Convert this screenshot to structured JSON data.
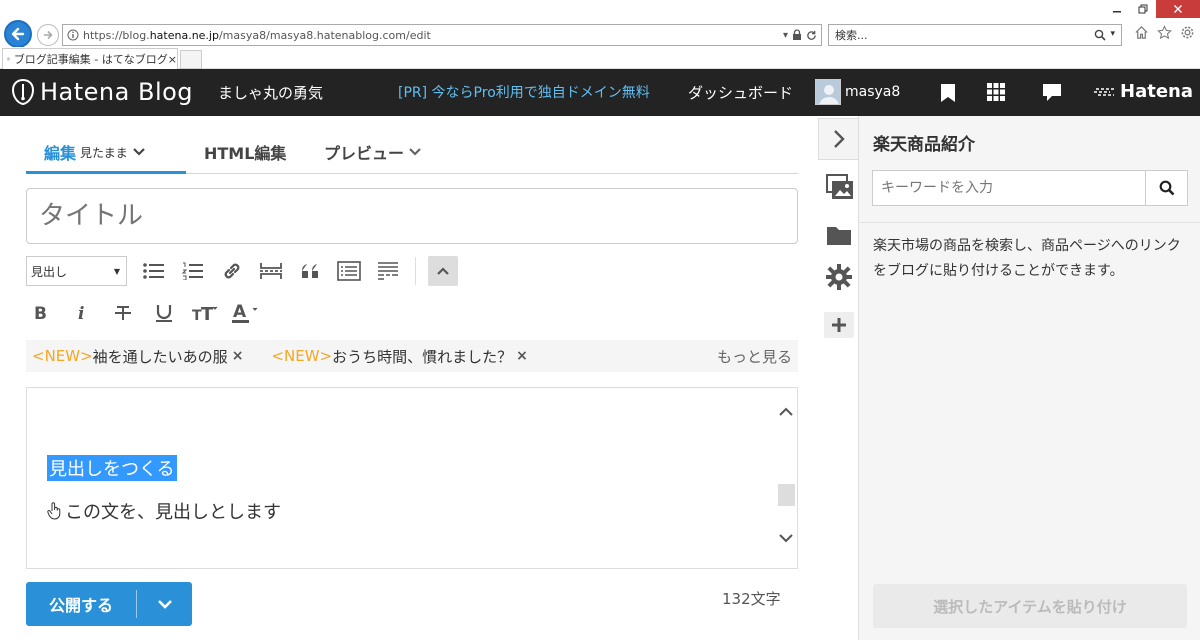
{
  "browser": {
    "url_prefix": "https://blog.",
    "url_domain": "hatena.ne.jp",
    "url_rest": "/masya8/masya8.hatenablog.com/edit",
    "search_placeholder": "検索...",
    "tab_title": "ブログ記事編集 - はてなブログ",
    "tab_close": "×"
  },
  "header": {
    "logo_text": "Hatena Blog",
    "blog_name": "ましゃ丸の勇気",
    "promo": "[PR] 今ならPro利用で独自ドメイン無料",
    "dashboard": "ダッシュボード",
    "username": "masya8",
    "brand": "Hatena"
  },
  "editor": {
    "tabs": [
      {
        "label": "編集",
        "sub": "見たまま"
      },
      {
        "label": "HTML編集"
      },
      {
        "label": "プレビュー"
      }
    ],
    "title_placeholder": "タイトル",
    "heading_select_value": "見出し",
    "news": [
      {
        "tag": "<NEW>",
        "text": "袖を通したいあの服"
      },
      {
        "tag": "<NEW>",
        "text": "おうち時間、慣れました？"
      }
    ],
    "news_close": "×",
    "news_more": "もっと見る",
    "content": {
      "heading": "見出しをつくる",
      "body": "この文を、見出しとします"
    },
    "publish_label": "公開する",
    "char_count": "132文字"
  },
  "panel": {
    "title": "楽天商品紹介",
    "search_placeholder": "キーワードを入力",
    "description": "楽天市場の商品を検索し、商品ページへのリンクをブログに貼り付けることができます。",
    "paste_button": "選択したアイテムを貼り付け"
  },
  "colors": {
    "accent": "#2a91d8",
    "header_bg": "#232323",
    "promo": "#5fbef2",
    "new_tag": "#f5a623",
    "selection": "#3399ff"
  }
}
